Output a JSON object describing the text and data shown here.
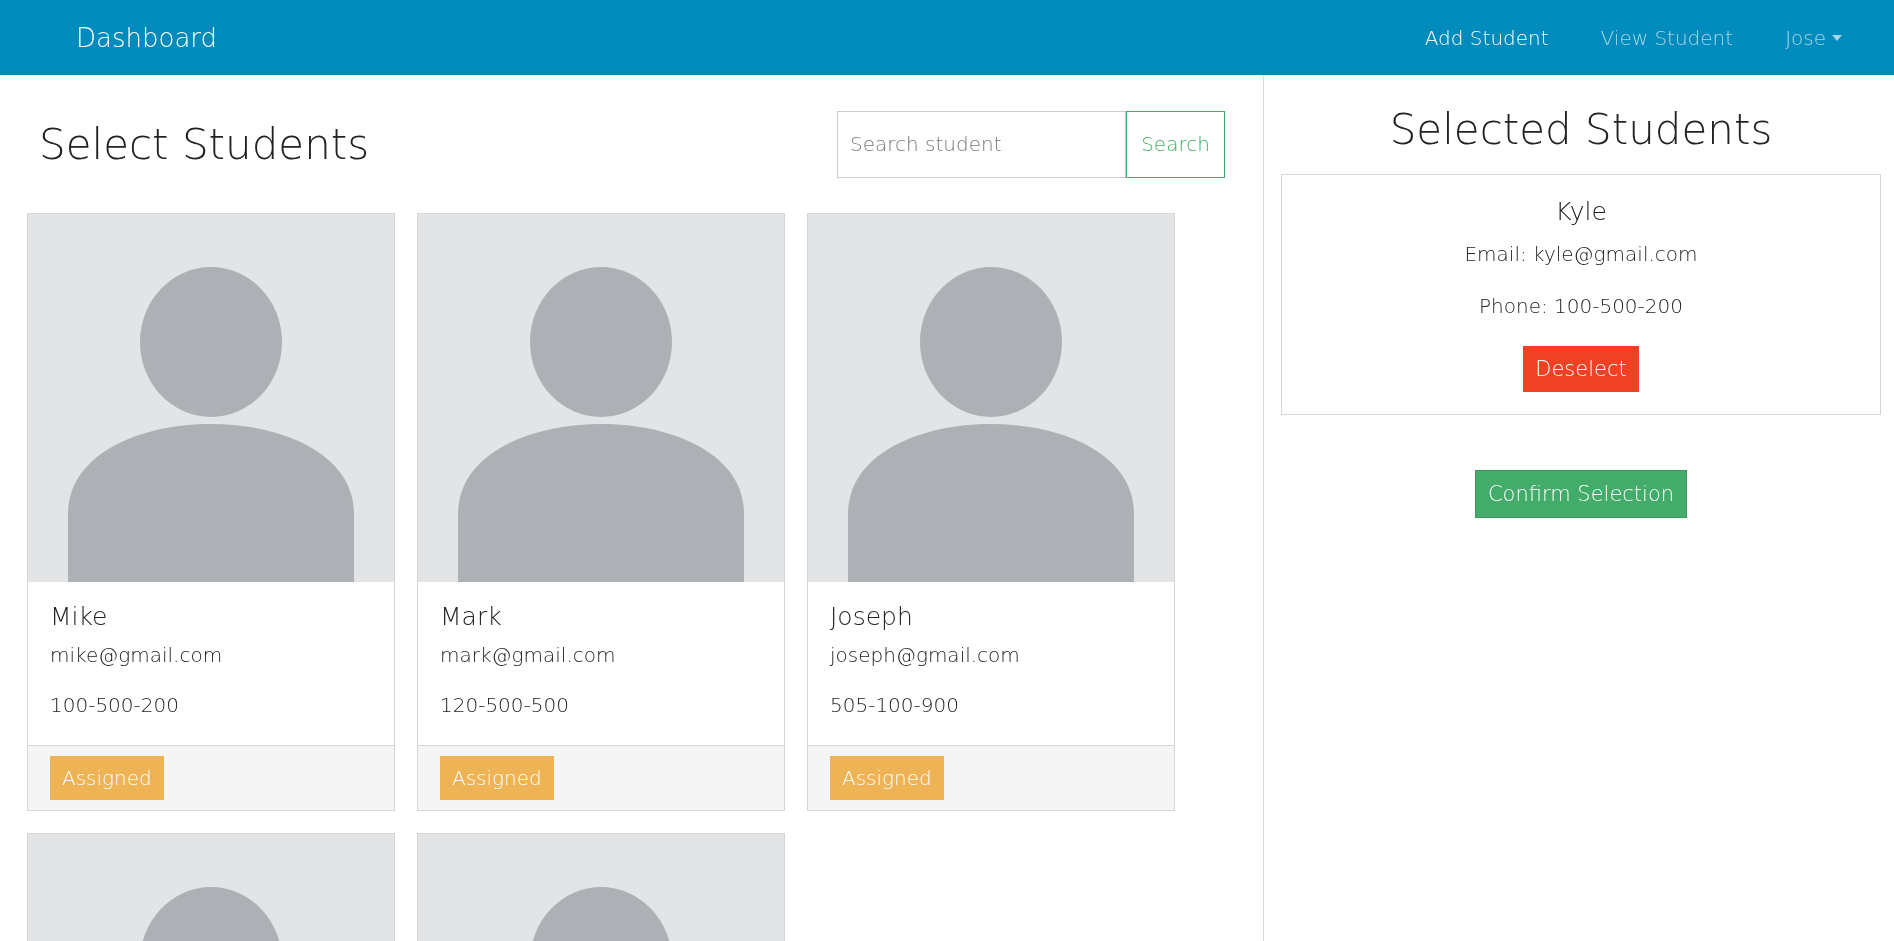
{
  "navbar": {
    "brand": "Dashboard",
    "links": [
      {
        "label": "Add Student",
        "selected": true,
        "kind": "link"
      },
      {
        "label": "View Student",
        "selected": false,
        "kind": "link"
      },
      {
        "label": "Jose",
        "selected": false,
        "kind": "dropdown"
      }
    ]
  },
  "select_panel": {
    "title": "Select Students",
    "search": {
      "placeholder": "Search student",
      "button": "Search"
    },
    "students": [
      {
        "kind": "full",
        "name": "Mike",
        "email": "mike@gmail.com",
        "phone": "100-500-200",
        "status": "Assigned"
      },
      {
        "kind": "full",
        "name": "Mark",
        "email": "mark@gmail.com",
        "phone": "120-500-500",
        "status": "Assigned"
      },
      {
        "kind": "full",
        "name": "Joseph",
        "email": "joseph@gmail.com",
        "phone": "505-100-900",
        "status": "Assigned"
      },
      {
        "kind": "partial"
      },
      {
        "kind": "partial"
      }
    ]
  },
  "selected_panel": {
    "title": "Selected Students",
    "students": [
      {
        "name": "Kyle",
        "email": "Email: kyle@gmail.com",
        "phone": "Phone: 100-500-200",
        "button": "Deselect"
      }
    ],
    "confirm_button": "Confirm Selection"
  }
}
